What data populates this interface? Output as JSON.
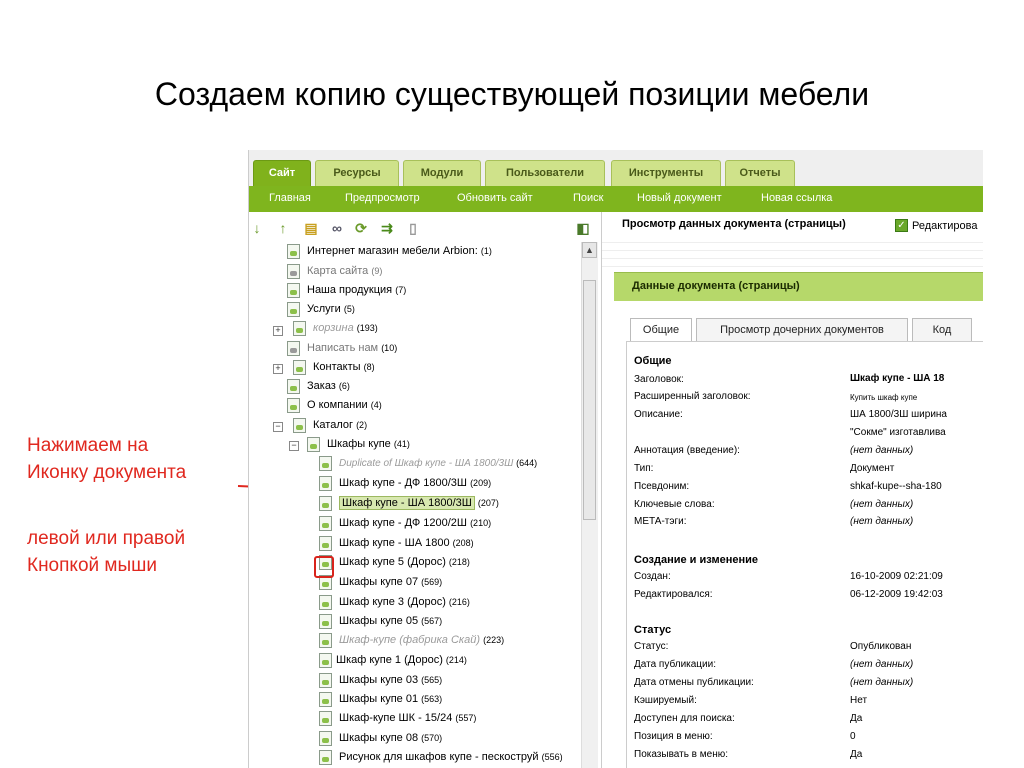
{
  "slide": {
    "title": "Создаем копию существующей позиции мебели",
    "annotation_line1": "Нажимаем на",
    "annotation_line2": "Иконку документа",
    "annotation_line3": "левой или правой",
    "annotation_line4": "Кнопкой мыши"
  },
  "colors": {
    "accent": "#7fb51e",
    "annotation": "#e0281f",
    "section": "#b6d86a"
  },
  "top_tabs": [
    {
      "label": "Сайт",
      "active": true
    },
    {
      "label": "Ресурсы"
    },
    {
      "label": "Модули"
    },
    {
      "label": "Пользователи"
    },
    {
      "label": "Инструменты"
    },
    {
      "label": "Отчеты"
    }
  ],
  "nav": [
    "Главная",
    "Предпросмотр",
    "Обновить сайт",
    "Поиск",
    "Новый документ",
    "Новая ссылка"
  ],
  "toolbar_icons": [
    "arrow-down-icon",
    "arrow-up-icon",
    "new-document-icon",
    "link-icon",
    "refresh-icon",
    "sort-icon",
    "trash-icon",
    "collapse-pane-icon"
  ],
  "tree": [
    {
      "text": "Интернет магазин мебели Arbion:",
      "count": "(1)"
    },
    {
      "text": "Карта сайта",
      "count": "(9)",
      "style": "gray"
    },
    {
      "text": "Наша продукция",
      "count": "(7)"
    },
    {
      "text": "Услуги",
      "count": "(5)"
    },
    {
      "text": "корзина",
      "count": "(193)",
      "style": "italic"
    },
    {
      "text": "Написать нам",
      "count": "(10)",
      "style": "gray"
    },
    {
      "text": "Контакты",
      "count": "(8)"
    },
    {
      "text": "Заказ",
      "count": "(6)"
    },
    {
      "text": "О компании",
      "count": "(4)"
    },
    {
      "text": "Каталог",
      "count": "(2)"
    },
    {
      "text": "Шкафы купе",
      "count": "(41)"
    },
    {
      "text": "Duplicate of Шкаф купе - ША 1800/3Ш",
      "count": "(644)",
      "style": "italic"
    },
    {
      "text": "Шкаф купе - ДФ 1800/3Ш",
      "count": "(209)"
    },
    {
      "text": "Шкаф купе - ША 1800/3Ш",
      "count": "(207)",
      "style": "sel"
    },
    {
      "text": "Шкаф купе - ДФ 1200/2Ш",
      "count": "(210)"
    },
    {
      "text": "Шкаф купе - ША 1800",
      "count": "(208)"
    },
    {
      "text": "Шкаф купе 5 (Дорос)",
      "count": "(218)"
    },
    {
      "text": "Шкафы купе 07",
      "count": "(569)"
    },
    {
      "text": "Шкаф купе 3 (Дорос)",
      "count": "(216)"
    },
    {
      "text": "Шкафы купе 05",
      "count": "(567)"
    },
    {
      "text": "Шкаф-купе (фабрика Скай)",
      "count": "(223)",
      "style": "italic"
    },
    {
      "text": "Шкаф купе 1 (Дорос)",
      "count": "(214)"
    },
    {
      "text": "Шкафы купе 03",
      "count": "(565)"
    },
    {
      "text": "Шкафы купе 01",
      "count": "(563)"
    },
    {
      "text": "Шкаф-купе ШК - 15/24",
      "count": "(557)"
    },
    {
      "text": "Шкафы купе 08",
      "count": "(570)"
    },
    {
      "text": "Рисунок для шкафов купе - пескоструй",
      "count": "(556)"
    }
  ],
  "right": {
    "title": "Просмотр данных документа (страницы)",
    "check_label": "Редактирова",
    "section_title": "Данные документа (страницы)",
    "subtabs": [
      "Общие",
      "Просмотр дочерних документов",
      "Код"
    ],
    "groups": [
      {
        "head": "Общие",
        "rows": [
          {
            "label": "Заголовок:",
            "value": "Шкаф купе - ША 18",
            "style": "bold"
          },
          {
            "label": "Расширенный заголовок:",
            "value": "Купить шкаф купе",
            "style": "small"
          },
          {
            "label": "Описание:",
            "value": "ША 1800/3Ш ширина"
          },
          {
            "label": "",
            "value": "\"Сокме\" изготавлива"
          },
          {
            "label": "Аннотация (введение):",
            "value": "(нет данных)",
            "style": "italic"
          },
          {
            "label": "Тип:",
            "value": "Документ"
          },
          {
            "label": "Псевдоним:",
            "value": "shkaf-kupe--sha-180"
          },
          {
            "label": "Ключевые слова:",
            "value": "(нет данных)",
            "style": "italic"
          },
          {
            "label": "МЕТА-тэги:",
            "value": "(нет данных)",
            "style": "italic"
          }
        ]
      },
      {
        "head": "Создание и изменение",
        "rows": [
          {
            "label": "Создан:",
            "value": "16-10-2009 02:21:09"
          },
          {
            "label": "Редактировался:",
            "value": "06-12-2009 19:42:03"
          }
        ]
      },
      {
        "head": "Статус",
        "rows": [
          {
            "label": "Статус:",
            "value": "Опубликован"
          },
          {
            "label": "Дата публикации:",
            "value": "(нет данных)",
            "style": "italic"
          },
          {
            "label": "Дата отмены публикации:",
            "value": "(нет данных)",
            "style": "italic"
          },
          {
            "label": "Кэшируемый:",
            "value": "Нет"
          },
          {
            "label": "Доступен для поиска:",
            "value": "Да"
          },
          {
            "label": "Позиция в меню:",
            "value": "0"
          },
          {
            "label": "Показывать в меню:",
            "value": "Да"
          }
        ]
      }
    ]
  }
}
